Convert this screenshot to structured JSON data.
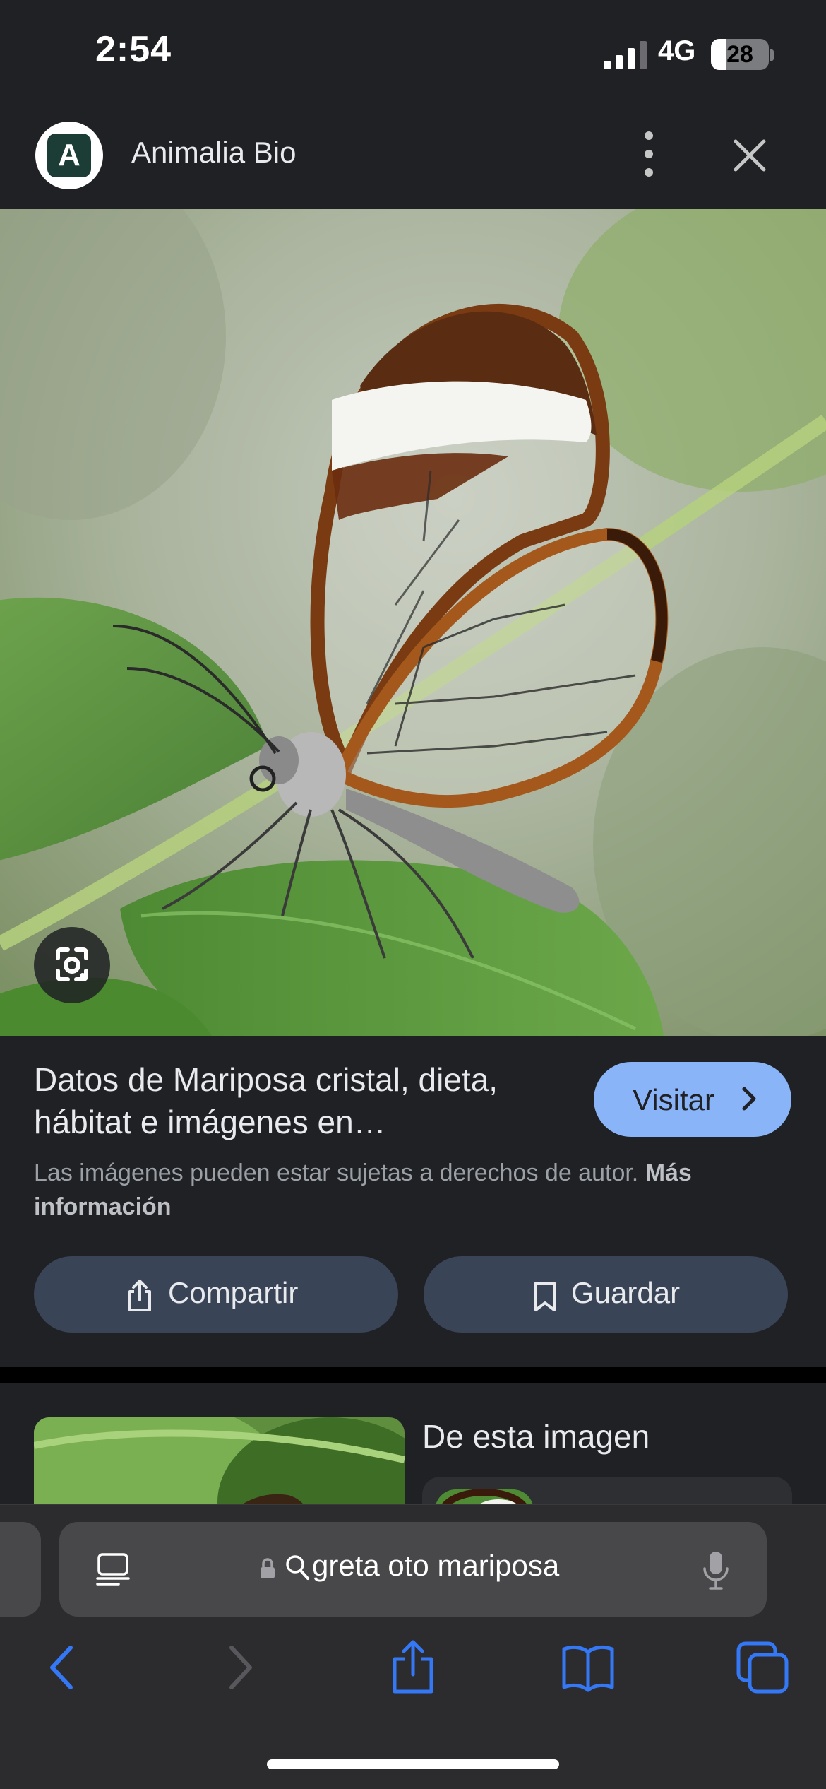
{
  "status_bar": {
    "time": "2:54",
    "network": "4G",
    "battery": "28"
  },
  "header": {
    "logo_letter": "A",
    "site_name": "Animalia Bio",
    "logo_color": "#1c3d36"
  },
  "result": {
    "title": "Datos de Mariposa cristal, dieta, hábitat e imágenes en…",
    "visit_label": "Visitar",
    "copyright_text": "Las imágenes pueden estar sujetas a derechos de autor.",
    "more_info_label": "Más información",
    "share_label": "Compartir",
    "save_label": "Guardar"
  },
  "related": {
    "heading": "De esta imagen"
  },
  "browser": {
    "address_text": "greta oto mariposa",
    "accent_color": "#3478f6"
  }
}
